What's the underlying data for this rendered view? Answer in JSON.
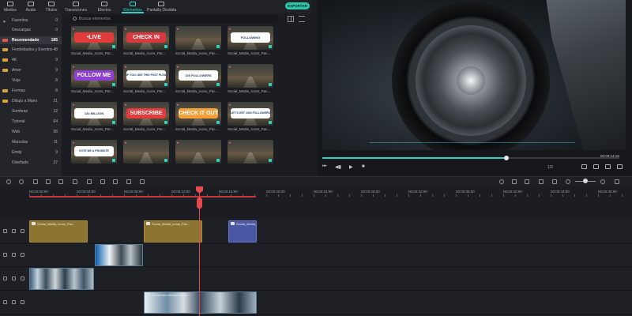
{
  "tabs": [
    {
      "label": "Medios",
      "icon": "media-icon"
    },
    {
      "label": "Audio",
      "icon": "audio-icon"
    },
    {
      "label": "Títulos",
      "icon": "titles-icon"
    },
    {
      "label": "Transiciones",
      "icon": "transitions-icon"
    },
    {
      "label": "Efectos",
      "icon": "effects-icon"
    },
    {
      "label": "Elementos",
      "icon": "elements-icon",
      "active": true
    },
    {
      "label": "Pantalla Dividida",
      "icon": "split-screen-icon"
    }
  ],
  "export_label": "EXPORTAR",
  "categories": [
    {
      "label": "Favoritos",
      "count": "0",
      "icon": "heart-icon"
    },
    {
      "label": "Descargas",
      "count": "0",
      "icon": ""
    },
    {
      "label": "Recomendado",
      "count": "185",
      "icon": "folder-icon",
      "selected": true
    },
    {
      "label": "Festividades y Eventos",
      "count": "48",
      "icon": "folder-icon"
    },
    {
      "label": "4K",
      "count": "9",
      "icon": "folder-icon"
    },
    {
      "label": "Amor",
      "count": "9",
      "icon": "folder-icon"
    },
    {
      "label": "Viaje",
      "count": "8",
      "icon": ""
    },
    {
      "label": "Formas",
      "count": "8",
      "icon": "folder-icon"
    },
    {
      "label": "Dibujo a Mano",
      "count": "21",
      "icon": "folder-icon"
    },
    {
      "label": "Sombras",
      "count": "12",
      "icon": ""
    },
    {
      "label": "Tutorial",
      "count": "64",
      "icon": ""
    },
    {
      "label": "Web",
      "count": "36",
      "icon": ""
    },
    {
      "label": "Marcolas",
      "count": "11",
      "icon": ""
    },
    {
      "label": "Emoji",
      "count": "9",
      "icon": ""
    },
    {
      "label": "Diseñado",
      "count": "27",
      "icon": ""
    }
  ],
  "search": {
    "placeholder": "Buscar elementos"
  },
  "media_items": [
    {
      "badge": "•LIVE",
      "badge_color": "#e23b3b",
      "caption": "Social_Media_Icons_Pac..."
    },
    {
      "badge": "CHECK IN",
      "badge_color": "#d8393f",
      "caption": "Social_Media_Icons_Pac..."
    },
    {
      "badge": "",
      "badge_color": "",
      "caption": "Social_Media_Icons_Pac..."
    },
    {
      "badge": "FOLLOWING",
      "badge_color": "#ffffff",
      "caption": "Social_Media_Icons_Pac..."
    },
    {
      "badge": "FOLLOW ME",
      "badge_color": "#8e3fd6",
      "caption": "Social_Media_Icons_Pac..."
    },
    {
      "badge": "IF YOU LIKE THIS POST PLEASE SUBSCRIBE",
      "badge_color": "#ffffff",
      "caption": "Social_Media_Icons_Pac..."
    },
    {
      "badge": "100 FOLLOWERS",
      "badge_color": "#ffffff",
      "caption": "Social_Media_Icons_Pac..."
    },
    {
      "badge": "",
      "badge_color": "",
      "caption": "Social_Media_Icons_Pac..."
    },
    {
      "badge": "144 MILLION",
      "badge_color": "#ffffff",
      "caption": "Social_Media_Icons_Pac..."
    },
    {
      "badge": "SUBSCRIBE",
      "badge_color": "#e23b3b",
      "caption": "Social_Media_Icons_Pac..."
    },
    {
      "badge": "CHECK IT OUT",
      "badge_color": "#f2a13a",
      "caption": "Social_Media_Icons_Pac..."
    },
    {
      "badge": "LET'S GET 1000 FOLLOWERS",
      "badge_color": "#ffffff",
      "caption": "Social_Media_Icons_Pac..."
    },
    {
      "badge": "VOTE ME & PROMOTE",
      "badge_color": "#ffffff",
      "caption": ""
    },
    {
      "badge": "",
      "badge_color": "",
      "caption": ""
    },
    {
      "badge": "",
      "badge_color": "",
      "caption": ""
    },
    {
      "badge": "",
      "badge_color": "",
      "caption": ""
    }
  ],
  "player": {
    "time": "00:00:14:19",
    "quality": "1/2",
    "progress": 0.62
  },
  "ruler_labels": [
    "00:00:00:00",
    "00:00:04:00",
    "00:00:08:00",
    "00:00:12:00",
    "00:00:16:00",
    "00:00:20:00",
    "00:00:24:00",
    "00:00:28:00",
    "00:00:32:00",
    "00:00:36:00",
    "00:00:40:00",
    "00:00:44:00",
    "00:00:48:00"
  ],
  "clips": {
    "track1": [
      {
        "label": "Social_Media_Icons_Pac...",
        "style": "gold"
      },
      {
        "label": "Social_Media_Icons_Pac...",
        "style": "gold"
      },
      {
        "label": "Social_Media_I...",
        "style": "violet"
      }
    ],
    "track2": [
      {
        "label": "",
        "style": "video3"
      }
    ],
    "track3": [
      {
        "label": "",
        "style": "video"
      }
    ],
    "track4": [
      {
        "label": "Social Intro Motion Graph...",
        "style": "video2"
      }
    ]
  }
}
